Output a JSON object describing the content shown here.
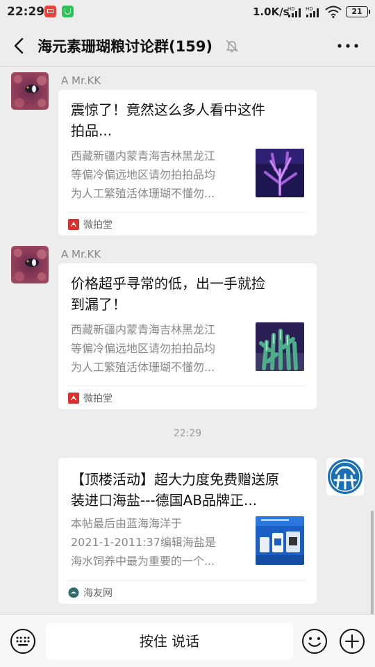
{
  "status_bar": {
    "time": "22:29",
    "net_speed": "1.0K/s",
    "signal1_label": "HD",
    "signal2_label": "HD",
    "battery": "21"
  },
  "header": {
    "title": "海元素珊瑚粮讨论群(159)"
  },
  "messages": [
    {
      "sender": "A  Mr.KK",
      "title_line1": "震惊了！竟然这么多人看中这件",
      "title_line2": "拍品...",
      "desc_line1": "西藏新疆内蒙青海吉林黑龙江",
      "desc_line2": "等偏冷偏远地区请勿拍拍品均",
      "desc_line3": "为人工繁殖活体珊瑚不懂勿...",
      "source": "微拍堂"
    },
    {
      "sender": "A  Mr.KK",
      "title_line1": "价格超乎寻常的低，出一手就捡",
      "title_line2": "到漏了！",
      "desc_line1": "西藏新疆内蒙青海吉林黑龙江",
      "desc_line2": "等偏冷偏远地区请勿拍拍品均",
      "desc_line3": "为人工繁殖活体珊瑚不懂勿...",
      "source": "微拍堂"
    },
    {
      "title_line1": "【顶楼活动】超大力度免费赠送原",
      "title_line2": "装进口海盐---德国AB品牌正...",
      "desc_line1": "本帖最后由蓝海海洋于",
      "desc_line2": "2021-1-2011:37编辑海盐是",
      "desc_line3": "海水饲养中最为重要的一个...",
      "source": "海友网"
    }
  ],
  "timestamp": "22:29",
  "input_bar": {
    "hold_to_talk": "按住 说话"
  },
  "colors": {
    "background": "#ededed",
    "card": "#ffffff",
    "source_red": "#d9322e",
    "source_teal": "#2f6b6b"
  }
}
